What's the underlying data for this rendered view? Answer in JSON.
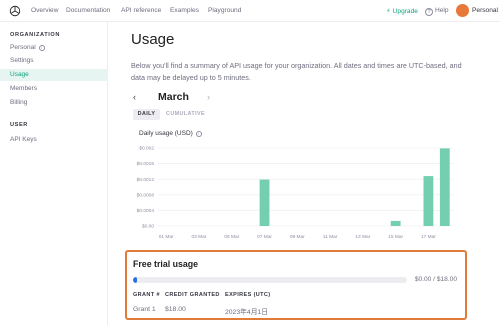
{
  "nav": {
    "links": [
      "Overview",
      "Documentation",
      "API reference",
      "Examples",
      "Playground"
    ],
    "upgrade_label": "Upgrade",
    "help_label": "Help",
    "account_label": "Personal"
  },
  "sidebar": {
    "org_heading": "ORGANIZATION",
    "org_name": "Personal",
    "org_items": [
      "Settings",
      "Usage",
      "Members",
      "Billing"
    ],
    "user_heading": "USER",
    "user_items": [
      "API Keys"
    ],
    "active_item": "Usage"
  },
  "main": {
    "title": "Usage",
    "description": "Below you'll find a summary of API usage for your organization. All dates and times are UTC-based, and data may be delayed up to 5 minutes.",
    "month": "March",
    "tabs": [
      "DAILY",
      "CUMULATIVE"
    ],
    "active_tab": "DAILY",
    "chart_title": "Daily usage (USD)"
  },
  "chart_data": {
    "type": "bar",
    "title": "Daily usage (USD)",
    "y_ticks": [
      "$0.00",
      "$0.0004",
      "$0.0008",
      "$0.0012",
      "$0.0016",
      "$0.002"
    ],
    "ylim": [
      0,
      0.002
    ],
    "x_tick_labels": [
      "01 Mar",
      "03 Mar",
      "05 Mar",
      "07 Mar",
      "09 Mar",
      "11 Mar",
      "13 Mar",
      "15 Mar",
      "17 Mar"
    ],
    "categories": [
      "01 Mar",
      "02 Mar",
      "03 Mar",
      "04 Mar",
      "05 Mar",
      "06 Mar",
      "07 Mar",
      "08 Mar",
      "09 Mar",
      "10 Mar",
      "11 Mar",
      "12 Mar",
      "13 Mar",
      "14 Mar",
      "15 Mar",
      "16 Mar",
      "17 Mar",
      "18 Mar"
    ],
    "values": [
      0,
      0,
      0,
      0,
      0,
      0,
      0.00119,
      0,
      0,
      0,
      0,
      0,
      0,
      0,
      0.00013,
      0,
      0.00128,
      0.00199
    ],
    "bar_color": "#74cfb1",
    "grid": true
  },
  "trial": {
    "title": "Free trial usage",
    "used_fraction": 0.006,
    "amount_text": "$0.00 / $18.00",
    "bar_color": "#2d6ee0",
    "columns": [
      "GRANT #",
      "CREDIT GRANTED",
      "EXPIRES (UTC)"
    ],
    "rows": [
      [
        "Grant 1",
        "$18.00",
        "2023年4月1日"
      ]
    ]
  },
  "colors": {
    "accent": "#10a37f",
    "highlight_border": "#e07b39",
    "avatar": "#e8773a"
  }
}
